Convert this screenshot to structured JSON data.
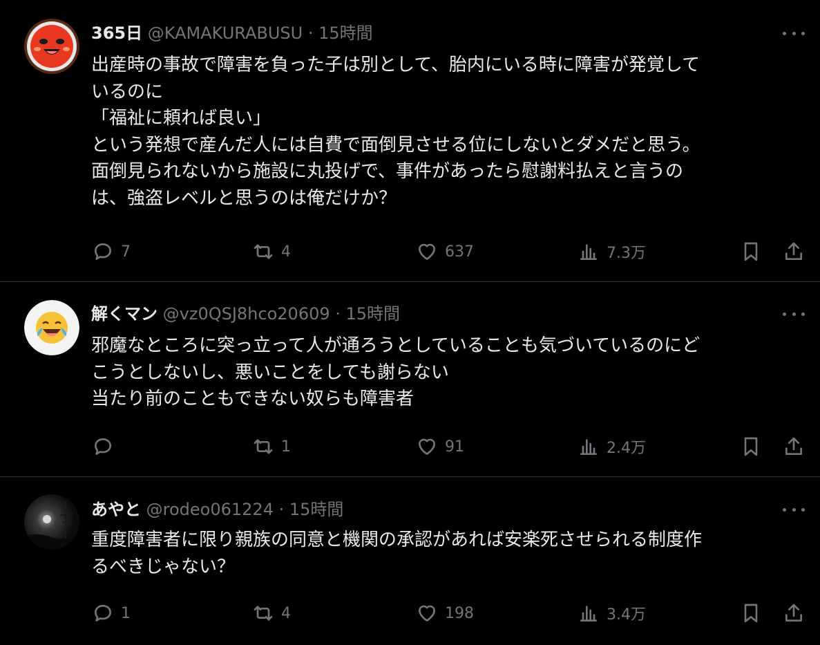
{
  "tweets": [
    {
      "display_name": "365日",
      "handle": "@KAMAKURABUSU",
      "time": "15時間",
      "text": "出産時の事故で障害を負った子は別として、胎内にいる時に障害が発覚して\nいるのに\n「福祉に頼れば良い」\nという発想で産んだ人には自費で面倒見させる位にしないとダメだと思う。\n面倒見られないから施設に丸投げで、事件があったら慰謝料払えと言うの\nは、強盗レベルと思うのは俺だけか？",
      "replies": "7",
      "retweets": "4",
      "likes": "637",
      "views": "7.3万"
    },
    {
      "display_name": "解くマン",
      "handle": "@vz0QSJ8hco20609",
      "time": "15時間",
      "text": "邪魔なところに突っ立って人が通ろうとしていることも気づいているのにど\nこうとしないし、悪いことをしても謝らない\n当たり前のこともできない奴らも障害者",
      "replies": "",
      "retweets": "1",
      "likes": "91",
      "views": "2.4万"
    },
    {
      "display_name": "あやと",
      "handle": "@rodeo061224",
      "time": "15時間",
      "text": "重度障害者に限り親族の同意と機関の承認があれば安楽死させられる制度作\nるべきじゃない？",
      "replies": "1",
      "retweets": "4",
      "likes": "198",
      "views": "3.4万"
    }
  ],
  "separator": " · ",
  "icons": {
    "avatar_1": "red-face-mascot-icon",
    "avatar_2": "laughing-tears-emoji",
    "avatar_3": "night-moon-photo",
    "reply": "reply-icon",
    "retweet": "retweet-icon",
    "like": "like-icon",
    "views": "views-icon",
    "bookmark": "bookmark-icon",
    "share": "share-icon",
    "more": "more-icon"
  },
  "colors": {
    "background": "#000000",
    "text": "#e7e9ea",
    "secondary": "#71767b",
    "divider": "#2f3336"
  }
}
